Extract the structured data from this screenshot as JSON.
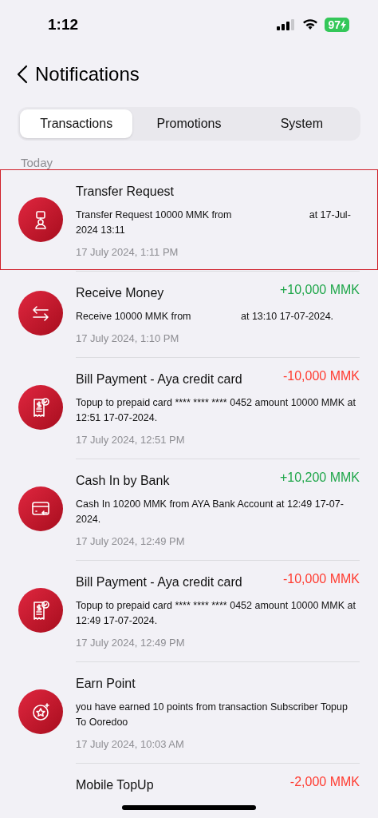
{
  "status_bar": {
    "time": "1:12",
    "battery": "97"
  },
  "header": {
    "title": "Notifications"
  },
  "tabs": [
    {
      "label": "Transactions",
      "selected": true
    },
    {
      "label": "Promotions",
      "selected": false
    },
    {
      "label": "System",
      "selected": false
    }
  ],
  "section": "Today",
  "notifications": [
    {
      "kind": "request",
      "title": "Transfer Request",
      "body": "Transfer Request 10000 MMK from                            at 17-Jul-2024 13:11",
      "date": "17 July 2024, 1:11 PM",
      "selected": true
    },
    {
      "kind": "exchange",
      "title": "Receive Money",
      "amount": "+10,000 MMK",
      "body": "Receive 10000 MMK from                  at 13:10 17-07-2024.",
      "date": "17 July 2024, 1:10 PM",
      "selected": false
    },
    {
      "kind": "bill",
      "title": "Bill Payment - Aya credit card",
      "amount": "-10,000 MMK",
      "body": "Topup to prepaid card **** **** **** 0452 amount 10000 MMK at 12:51 17-07-2024.",
      "date": "17 July 2024, 12:51 PM",
      "selected": false
    },
    {
      "kind": "card",
      "title": "Cash In by Bank",
      "amount": "+10,200 MMK",
      "body": "Cash In 10200 MMK from AYA Bank Account at 12:49 17-07-2024.",
      "date": "17 July 2024, 12:49 PM",
      "selected": false
    },
    {
      "kind": "bill",
      "title": "Bill Payment - Aya credit card",
      "amount": "-10,000 MMK",
      "body": "Topup to prepaid card **** **** **** 0452 amount 10000 MMK at 12:49 17-07-2024.",
      "date": "17 July 2024, 12:49 PM",
      "selected": false
    },
    {
      "kind": "star",
      "title": "Earn Point",
      "body": "you have earned 10 points from transaction Subscriber Topup To Ooredoo",
      "date": "17 July 2024, 10:03 AM",
      "selected": false
    },
    {
      "kind": "plain",
      "title": "Mobile TopUp",
      "amount": "-2,000 MMK",
      "selected": false
    }
  ]
}
